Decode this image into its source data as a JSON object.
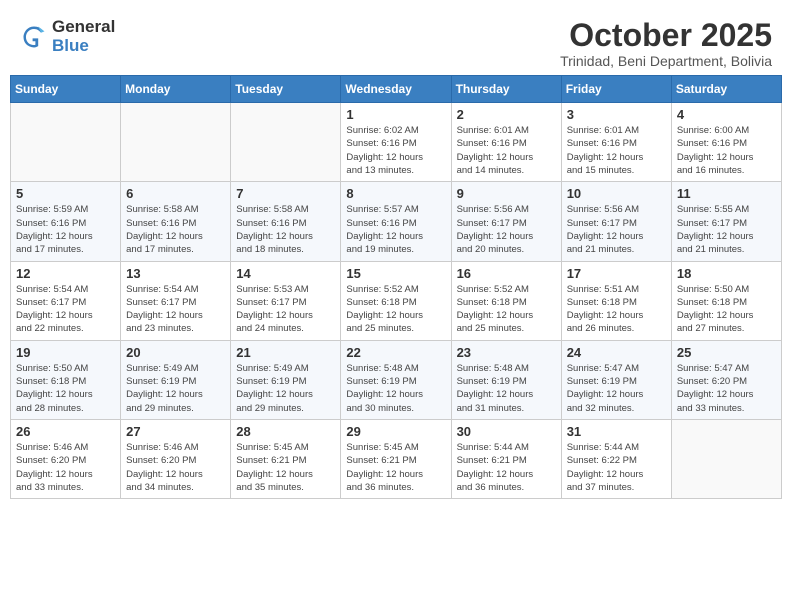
{
  "logo": {
    "text1": "General",
    "text2": "Blue"
  },
  "title": "October 2025",
  "subtitle": "Trinidad, Beni Department, Bolivia",
  "days_of_week": [
    "Sunday",
    "Monday",
    "Tuesday",
    "Wednesday",
    "Thursday",
    "Friday",
    "Saturday"
  ],
  "weeks": [
    [
      {
        "day": "",
        "info": ""
      },
      {
        "day": "",
        "info": ""
      },
      {
        "day": "",
        "info": ""
      },
      {
        "day": "1",
        "info": "Sunrise: 6:02 AM\nSunset: 6:16 PM\nDaylight: 12 hours\nand 13 minutes."
      },
      {
        "day": "2",
        "info": "Sunrise: 6:01 AM\nSunset: 6:16 PM\nDaylight: 12 hours\nand 14 minutes."
      },
      {
        "day": "3",
        "info": "Sunrise: 6:01 AM\nSunset: 6:16 PM\nDaylight: 12 hours\nand 15 minutes."
      },
      {
        "day": "4",
        "info": "Sunrise: 6:00 AM\nSunset: 6:16 PM\nDaylight: 12 hours\nand 16 minutes."
      }
    ],
    [
      {
        "day": "5",
        "info": "Sunrise: 5:59 AM\nSunset: 6:16 PM\nDaylight: 12 hours\nand 17 minutes."
      },
      {
        "day": "6",
        "info": "Sunrise: 5:58 AM\nSunset: 6:16 PM\nDaylight: 12 hours\nand 17 minutes."
      },
      {
        "day": "7",
        "info": "Sunrise: 5:58 AM\nSunset: 6:16 PM\nDaylight: 12 hours\nand 18 minutes."
      },
      {
        "day": "8",
        "info": "Sunrise: 5:57 AM\nSunset: 6:16 PM\nDaylight: 12 hours\nand 19 minutes."
      },
      {
        "day": "9",
        "info": "Sunrise: 5:56 AM\nSunset: 6:17 PM\nDaylight: 12 hours\nand 20 minutes."
      },
      {
        "day": "10",
        "info": "Sunrise: 5:56 AM\nSunset: 6:17 PM\nDaylight: 12 hours\nand 21 minutes."
      },
      {
        "day": "11",
        "info": "Sunrise: 5:55 AM\nSunset: 6:17 PM\nDaylight: 12 hours\nand 21 minutes."
      }
    ],
    [
      {
        "day": "12",
        "info": "Sunrise: 5:54 AM\nSunset: 6:17 PM\nDaylight: 12 hours\nand 22 minutes."
      },
      {
        "day": "13",
        "info": "Sunrise: 5:54 AM\nSunset: 6:17 PM\nDaylight: 12 hours\nand 23 minutes."
      },
      {
        "day": "14",
        "info": "Sunrise: 5:53 AM\nSunset: 6:17 PM\nDaylight: 12 hours\nand 24 minutes."
      },
      {
        "day": "15",
        "info": "Sunrise: 5:52 AM\nSunset: 6:18 PM\nDaylight: 12 hours\nand 25 minutes."
      },
      {
        "day": "16",
        "info": "Sunrise: 5:52 AM\nSunset: 6:18 PM\nDaylight: 12 hours\nand 25 minutes."
      },
      {
        "day": "17",
        "info": "Sunrise: 5:51 AM\nSunset: 6:18 PM\nDaylight: 12 hours\nand 26 minutes."
      },
      {
        "day": "18",
        "info": "Sunrise: 5:50 AM\nSunset: 6:18 PM\nDaylight: 12 hours\nand 27 minutes."
      }
    ],
    [
      {
        "day": "19",
        "info": "Sunrise: 5:50 AM\nSunset: 6:18 PM\nDaylight: 12 hours\nand 28 minutes."
      },
      {
        "day": "20",
        "info": "Sunrise: 5:49 AM\nSunset: 6:19 PM\nDaylight: 12 hours\nand 29 minutes."
      },
      {
        "day": "21",
        "info": "Sunrise: 5:49 AM\nSunset: 6:19 PM\nDaylight: 12 hours\nand 29 minutes."
      },
      {
        "day": "22",
        "info": "Sunrise: 5:48 AM\nSunset: 6:19 PM\nDaylight: 12 hours\nand 30 minutes."
      },
      {
        "day": "23",
        "info": "Sunrise: 5:48 AM\nSunset: 6:19 PM\nDaylight: 12 hours\nand 31 minutes."
      },
      {
        "day": "24",
        "info": "Sunrise: 5:47 AM\nSunset: 6:19 PM\nDaylight: 12 hours\nand 32 minutes."
      },
      {
        "day": "25",
        "info": "Sunrise: 5:47 AM\nSunset: 6:20 PM\nDaylight: 12 hours\nand 33 minutes."
      }
    ],
    [
      {
        "day": "26",
        "info": "Sunrise: 5:46 AM\nSunset: 6:20 PM\nDaylight: 12 hours\nand 33 minutes."
      },
      {
        "day": "27",
        "info": "Sunrise: 5:46 AM\nSunset: 6:20 PM\nDaylight: 12 hours\nand 34 minutes."
      },
      {
        "day": "28",
        "info": "Sunrise: 5:45 AM\nSunset: 6:21 PM\nDaylight: 12 hours\nand 35 minutes."
      },
      {
        "day": "29",
        "info": "Sunrise: 5:45 AM\nSunset: 6:21 PM\nDaylight: 12 hours\nand 36 minutes."
      },
      {
        "day": "30",
        "info": "Sunrise: 5:44 AM\nSunset: 6:21 PM\nDaylight: 12 hours\nand 36 minutes."
      },
      {
        "day": "31",
        "info": "Sunrise: 5:44 AM\nSunset: 6:22 PM\nDaylight: 12 hours\nand 37 minutes."
      },
      {
        "day": "",
        "info": ""
      }
    ]
  ]
}
